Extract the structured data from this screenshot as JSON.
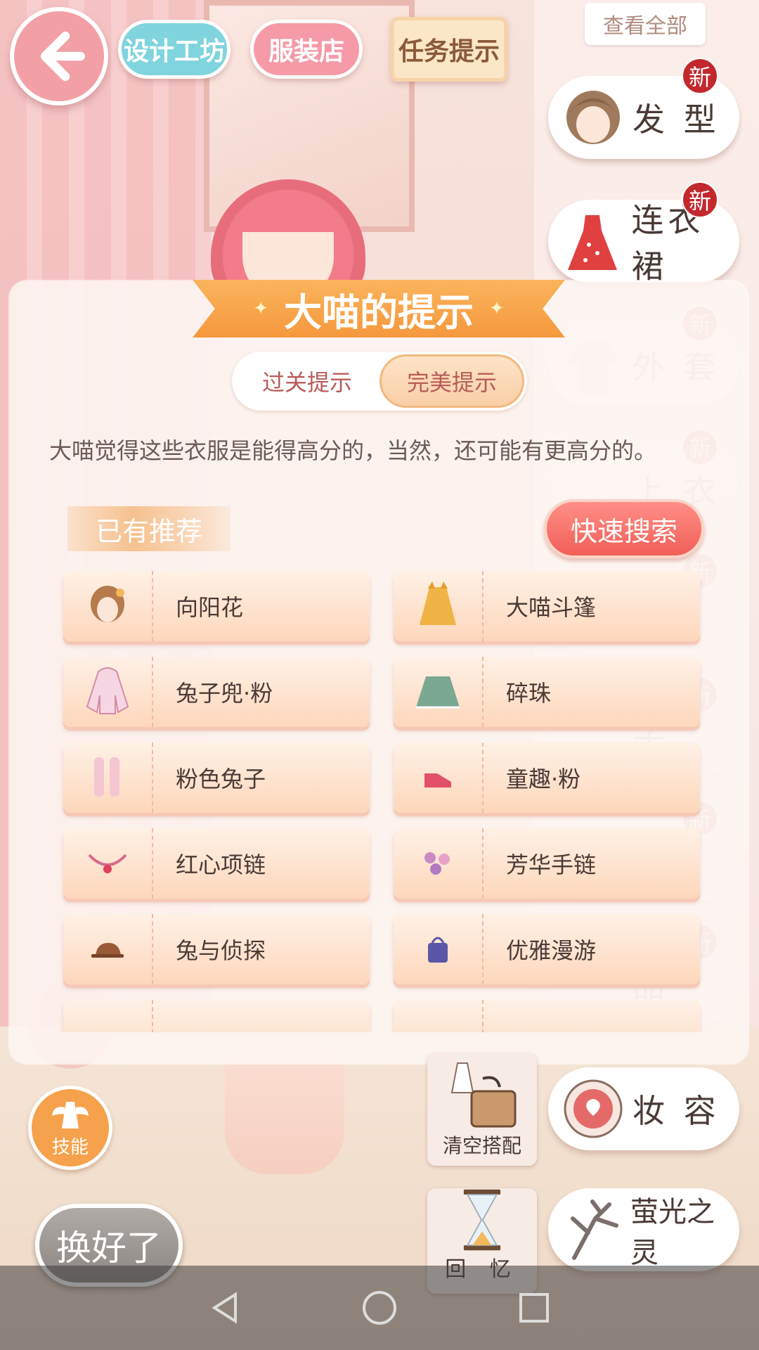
{
  "top_bar": {
    "design_workshop": "设计工坊",
    "clothing_store": "服装店",
    "task_hint": "任务提示",
    "view_all": "查看全部"
  },
  "categories": [
    {
      "label": "发 型",
      "icon": "hairstyle-icon",
      "badge": "新"
    },
    {
      "label": "连衣裙",
      "icon": "dress-icon",
      "badge": "新"
    },
    {
      "label": "外 套",
      "icon": "coat-icon",
      "badge": "新"
    },
    {
      "label": "上 衣",
      "icon": "top-icon",
      "badge": "新"
    },
    {
      "label": "装",
      "icon": "outfit-icon",
      "badge": "新"
    },
    {
      "label": "子",
      "icon": "socks-icon",
      "badge": "新"
    },
    {
      "label": "子",
      "icon": "shoes-icon",
      "badge": "新"
    },
    {
      "label": "品",
      "icon": "accessory-icon",
      "badge": "新"
    }
  ],
  "hint_panel": {
    "title": "大喵的提示",
    "tabs": [
      "过关提示",
      "完美提示"
    ],
    "active_tab": "完美提示",
    "description": "大喵觉得这些衣服是能得高分的，当然，还可能有更高分的。",
    "recommended_header": "已有推荐",
    "quick_search": "快速搜索",
    "items": [
      {
        "name": "向阳花",
        "icon": "hair-item-icon"
      },
      {
        "name": "大喵斗篷",
        "icon": "cape-item-icon"
      },
      {
        "name": "兔子兜·粉",
        "icon": "hoodie-item-icon"
      },
      {
        "name": "碎珠",
        "icon": "skirt-item-icon"
      },
      {
        "name": "粉色兔子",
        "icon": "socks-item-icon"
      },
      {
        "name": "童趣·粉",
        "icon": "shoes-item-icon"
      },
      {
        "name": "红心项链",
        "icon": "necklace-item-icon"
      },
      {
        "name": "芳华手链",
        "icon": "bracelet-item-icon"
      },
      {
        "name": "兔与侦探",
        "icon": "hat-item-icon"
      },
      {
        "name": "优雅漫游",
        "icon": "bag-item-icon"
      }
    ]
  },
  "bottom": {
    "skill": "技能",
    "clear_outfit": "清空搭配",
    "memory": "回 忆",
    "makeup": "妆 容",
    "firefly": "萤光之灵",
    "done": "换好了"
  },
  "colors": {
    "accent_orange": "#f5983d",
    "quick_search_red": "#f05f57",
    "badge_red": "#c3282d",
    "back_pink": "#f2a0a5"
  }
}
